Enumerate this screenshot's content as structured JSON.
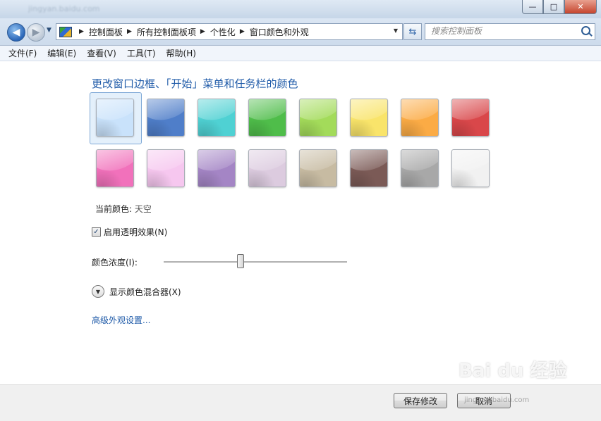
{
  "titlebar": {
    "blurred_text": "jingyan.baidu.com",
    "minimize": "—",
    "maximize": "□",
    "close": "✕"
  },
  "nav": {
    "back_glyph": "◀",
    "forward_glyph": "▶",
    "recent_glyph": "▼",
    "breadcrumbs": [
      "控制面板",
      "所有控制面板项",
      "个性化",
      "窗口颜色和外观"
    ],
    "crumb_separator": "▶",
    "dropdown_glyph": "▼",
    "refresh_glyph": "⇆",
    "search_placeholder": "搜索控制面板"
  },
  "menubar": {
    "items": [
      "文件(F)",
      "编辑(E)",
      "查看(V)",
      "工具(T)",
      "帮助(H)"
    ]
  },
  "content": {
    "heading": "更改窗口边框、「开始」菜单和任务栏的颜色",
    "swatches": [
      {
        "name": "sky",
        "color": "#c9e2fb",
        "selected": true
      },
      {
        "name": "twilight",
        "color": "#4f7ec9"
      },
      {
        "name": "sea",
        "color": "#4fd1d3"
      },
      {
        "name": "leaf",
        "color": "#4fbd4a"
      },
      {
        "name": "lime",
        "color": "#a3db5a"
      },
      {
        "name": "lemon",
        "color": "#f9e46a"
      },
      {
        "name": "tangerine",
        "color": "#fbab45"
      },
      {
        "name": "ruby",
        "color": "#d9474a"
      },
      {
        "name": "fuchsia",
        "color": "#f171bb"
      },
      {
        "name": "blush",
        "color": "#f6c7ef"
      },
      {
        "name": "violet",
        "color": "#a485c5"
      },
      {
        "name": "lavender",
        "color": "#dccbdf"
      },
      {
        "name": "taupe",
        "color": "#c7bba2"
      },
      {
        "name": "chocolate",
        "color": "#7b5a56"
      },
      {
        "name": "slate",
        "color": "#a8a8a8"
      },
      {
        "name": "frost",
        "color": "#f1f1f1"
      }
    ],
    "current_color_label": "当前颜色:",
    "current_color_value": "天空",
    "transparency_label": "启用透明效果(N)",
    "transparency_checked": true,
    "check_glyph": "✓",
    "intensity_label": "颜色浓度(I):",
    "intensity_fraction": 0.42,
    "mixer_glyph": "▼",
    "mixer_label": "显示颜色混合器(X)",
    "advanced_link": "高级外观设置..."
  },
  "footer": {
    "save_label": "保存修改",
    "cancel_label": "取消"
  },
  "watermark": {
    "text": "Bai du 经验",
    "sub": "jingyan.baidu.com"
  }
}
